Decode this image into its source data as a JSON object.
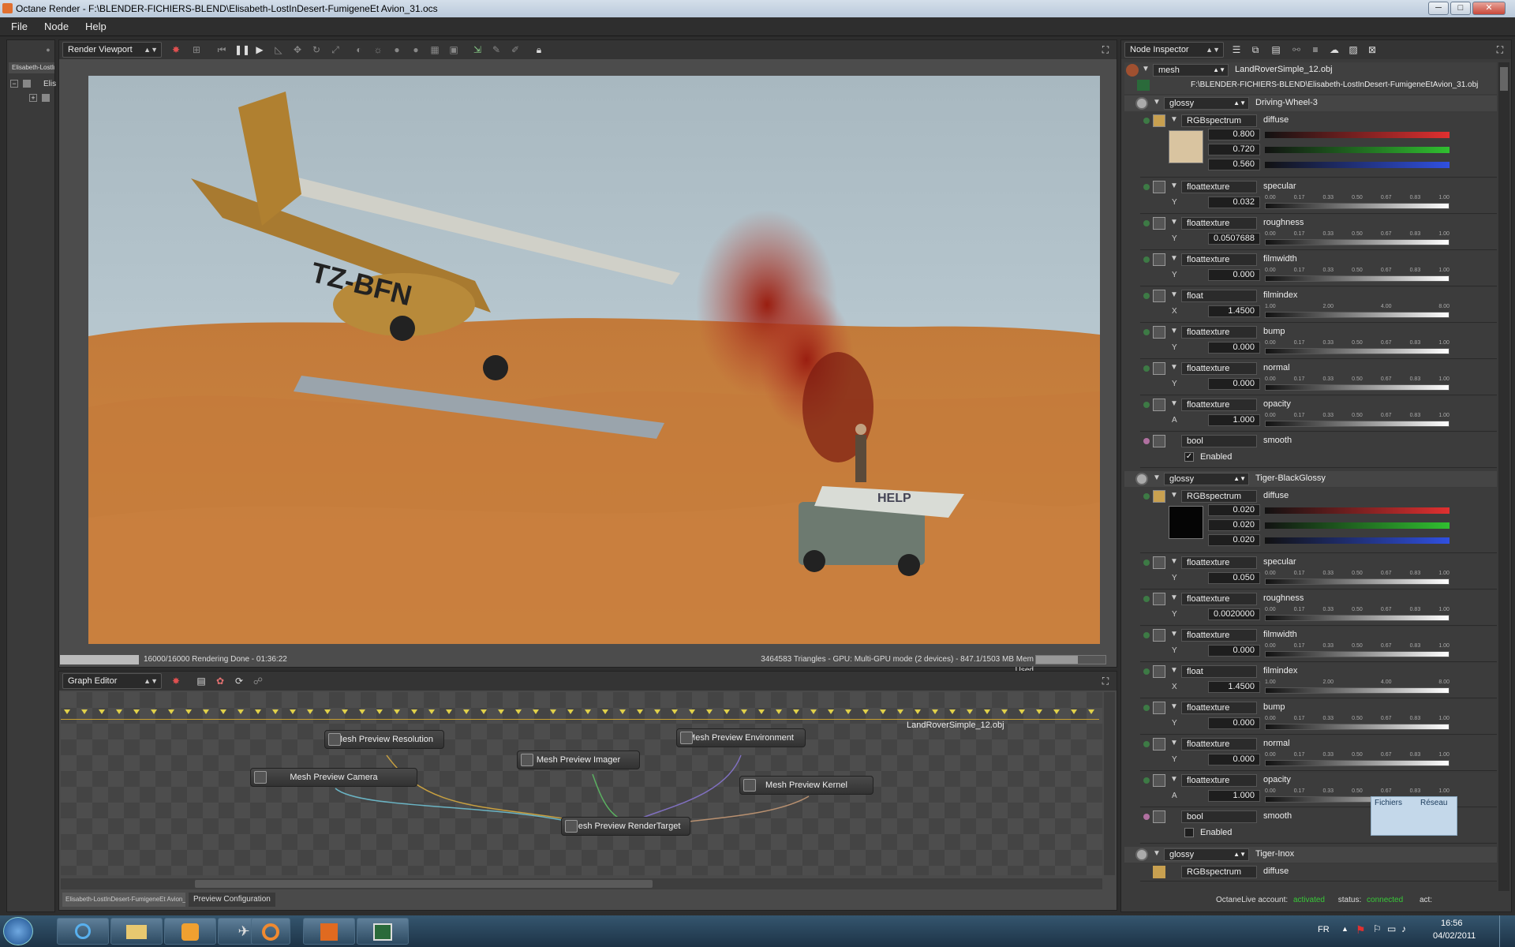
{
  "window": {
    "title": "Octane Render - F:\\BLENDER-FICHIERS-BLEND\\Elisabeth-LostInDesert-FumigeneEt Avion_31.ocs",
    "btn_min": "─",
    "btn_max": "□",
    "btn_close": "✕"
  },
  "menu": {
    "file": "File",
    "node": "Node",
    "help": "Help"
  },
  "scene_tree": {
    "tab_label": "Elisabeth-LostInDe",
    "root_label": "Elis",
    "expand": "+",
    "collapse": "−"
  },
  "viewport": {
    "mode": "Render Viewport",
    "status_left": "16000/16000 Rendering Done - 01:36:22",
    "status_right": "3464583 Triangles - GPU: Multi-GPU mode (2 devices) - 847.1/1503 MB Mem Used",
    "progress_fraction": 1.0,
    "plane_registration": "TZ-BFN",
    "banner_text": "HELP"
  },
  "graph_editor": {
    "mode": "Graph Editor",
    "mesh_label": "LandRoverSimple_12.obj",
    "nodes": {
      "resolution": "Mesh Preview Resolution",
      "environment": "Mesh Preview Environment",
      "imager": "Mesh Preview Imager",
      "camera": "Mesh Preview Camera",
      "kernel": "Mesh Preview Kernel",
      "rendertarget": "Mesh Preview RenderTarget"
    },
    "tabs": [
      "Elisabeth-LostInDesert-FumigeneEt Avion_31",
      "Preview Configuration"
    ]
  },
  "inspector": {
    "mode": "Node Inspector",
    "mesh_type": "mesh",
    "mesh_name": "LandRoverSimple_12.obj",
    "mesh_path": "F:\\BLENDER-FICHIERS-BLEND\\Elisabeth-LostInDesert-FumigeneEtAvion_31.obj",
    "materials": [
      {
        "type": "glossy",
        "name": "Driving-Wheel-3",
        "diffuse_type": "RGBspectrum",
        "diffuse_label": "diffuse",
        "diffuse_values": [
          "0.800",
          "0.720",
          "0.560"
        ],
        "swatch": "#d9c4a0",
        "rows": [
          {
            "type": "floattexture",
            "label": "specular",
            "axis": "Y",
            "value": "0.032"
          },
          {
            "type": "floattexture",
            "label": "roughness",
            "axis": "Y",
            "value": "0.0507688"
          },
          {
            "type": "floattexture",
            "label": "filmwidth",
            "axis": "Y",
            "value": "0.000"
          },
          {
            "type": "float",
            "label": "filmindex",
            "axis": "X",
            "value": "1.4500"
          },
          {
            "type": "floattexture",
            "label": "bump",
            "axis": "Y",
            "value": "0.000"
          },
          {
            "type": "floattexture",
            "label": "normal",
            "axis": "Y",
            "value": "0.000"
          },
          {
            "type": "floattexture",
            "label": "opacity",
            "axis": "A",
            "value": "1.000"
          }
        ],
        "smooth_type": "bool",
        "smooth_label": "smooth",
        "smooth_value": "Enabled",
        "smooth_check": "✓"
      },
      {
        "type": "glossy",
        "name": "Tiger-BlackGlossy",
        "diffuse_type": "RGBspectrum",
        "diffuse_label": "diffuse",
        "diffuse_values": [
          "0.020",
          "0.020",
          "0.020"
        ],
        "swatch": "#050505",
        "rows": [
          {
            "type": "floattexture",
            "label": "specular",
            "axis": "Y",
            "value": "0.050"
          },
          {
            "type": "floattexture",
            "label": "roughness",
            "axis": "Y",
            "value": "0.0020000"
          },
          {
            "type": "floattexture",
            "label": "filmwidth",
            "axis": "Y",
            "value": "0.000"
          },
          {
            "type": "float",
            "label": "filmindex",
            "axis": "X",
            "value": "1.4500"
          },
          {
            "type": "floattexture",
            "label": "bump",
            "axis": "Y",
            "value": "0.000"
          },
          {
            "type": "floattexture",
            "label": "normal",
            "axis": "Y",
            "value": "0.000"
          },
          {
            "type": "floattexture",
            "label": "opacity",
            "axis": "A",
            "value": "1.000"
          }
        ],
        "smooth_type": "bool",
        "smooth_label": "smooth",
        "smooth_value": "Enabled",
        "smooth_check": ""
      },
      {
        "type": "glossy",
        "name": "Tiger-Inox",
        "diffuse_type": "RGBspectrum",
        "diffuse_label": "diffuse"
      }
    ],
    "ticks_0_1": [
      "0.00",
      "0.17",
      "0.33",
      "0.50",
      "0.67",
      "0.83",
      "1.00"
    ],
    "ticks_film": [
      "1.00",
      "2.00",
      "4.00",
      "8.00"
    ],
    "popup": {
      "left": "Fichiers",
      "right": "Réseau"
    }
  },
  "account": {
    "label": "OctaneLive account:",
    "state": "activated",
    "status_label": "status:",
    "status": "connected",
    "act": "act:"
  },
  "taskbar": {
    "lang": "FR",
    "time": "16:56",
    "date": "04/02/2011"
  },
  "colors": {
    "accent_green": "#38c838",
    "node_pin": "#e0d04a"
  }
}
